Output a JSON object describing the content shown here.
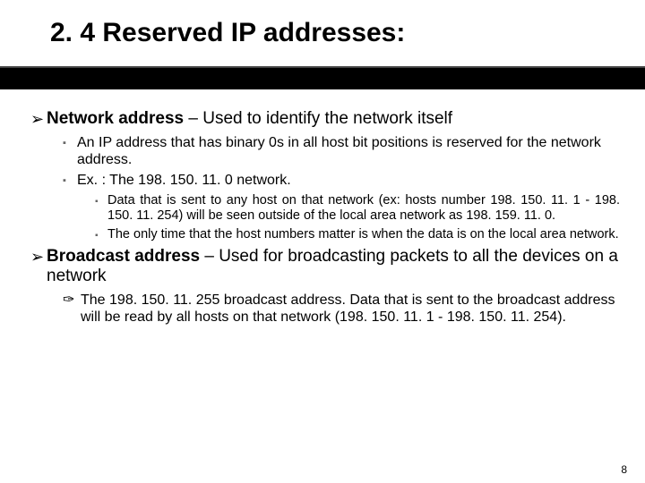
{
  "title": "2. 4 Reserved IP addresses:",
  "bullets": {
    "b1_bold": "Network address",
    "b1_rest": " – Used to identify the network itself",
    "b1_1": "An IP address that has binary 0s in all host bit positions is reserved for the network address.",
    "b1_2": "Ex. : The 198. 150. 11. 0 network.",
    "b1_2_1": "Data that is sent to any host on that network (ex: hosts number 198. 150. 11. 1 - 198. 150. 11. 254) will be seen outside of the local area network as 198. 159. 11. 0.",
    "b1_2_2": "The only time that the host numbers matter is when the data is on the local area network.",
    "b2_bold": "Broadcast address",
    "b2_rest": " – Used for broadcasting packets to all the devices on a network",
    "b2_1": "The 198. 150. 11. 255 broadcast address. Data that is sent to the broadcast address will be read by all hosts on that network (198. 150. 11. 1 - 198. 150. 11. 254)."
  },
  "glyphs": {
    "arrow": "➢",
    "square": "▪",
    "curl": "✑"
  },
  "page": "8"
}
